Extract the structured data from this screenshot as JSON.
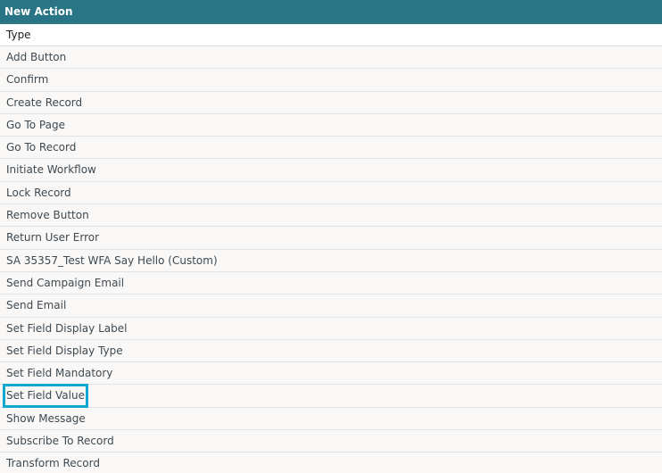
{
  "dialog": {
    "title": "New Action",
    "column_header": "Type",
    "highlight_color": "#11a8d0",
    "header_color": "#2a7585",
    "items": [
      {
        "label": "Add Button"
      },
      {
        "label": "Confirm"
      },
      {
        "label": "Create Record"
      },
      {
        "label": "Go To Page"
      },
      {
        "label": "Go To Record"
      },
      {
        "label": "Initiate Workflow"
      },
      {
        "label": "Lock Record"
      },
      {
        "label": "Remove Button"
      },
      {
        "label": "Return User Error"
      },
      {
        "label": "SA 35357_Test WFA Say Hello (Custom)"
      },
      {
        "label": "Send Campaign Email"
      },
      {
        "label": "Send Email"
      },
      {
        "label": "Set Field Display Label"
      },
      {
        "label": "Set Field Display Type"
      },
      {
        "label": "Set Field Mandatory"
      },
      {
        "label": "Set Field Value",
        "highlighted": true
      },
      {
        "label": "Show Message"
      },
      {
        "label": "Subscribe To Record"
      },
      {
        "label": "Transform Record"
      }
    ]
  }
}
